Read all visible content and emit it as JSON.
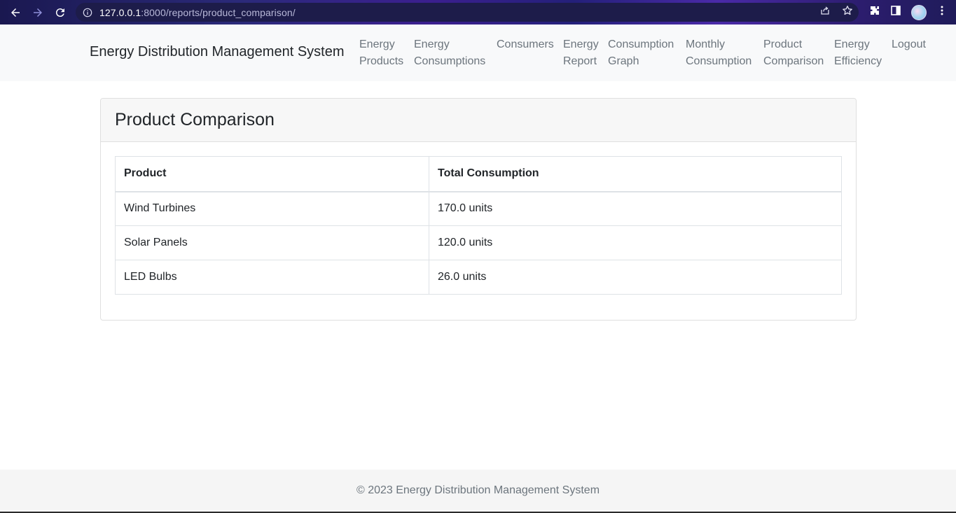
{
  "browser": {
    "url_host": "127.0.0.1",
    "url_rest": ":8000/reports/product_comparison/",
    "icons": [
      "back-arrow-icon",
      "forward-arrow-icon",
      "reload-icon",
      "info-icon",
      "share-icon",
      "star-icon",
      "extensions-icon",
      "side-panel-icon",
      "profile-avatar",
      "more-menu-icon"
    ]
  },
  "navbar": {
    "brand": "Energy Distribution Management System",
    "links": [
      {
        "line1": "Energy",
        "line2": "Products"
      },
      {
        "line1": "Energy",
        "line2": "Consumptions"
      },
      {
        "line1": "Consumers",
        "line2": ""
      },
      {
        "line1": "Energy",
        "line2": "Report"
      },
      {
        "line1": "Consumption",
        "line2": "Graph"
      },
      {
        "line1": "Monthly",
        "line2": "Consumption"
      },
      {
        "line1": "Product",
        "line2": "Comparison"
      },
      {
        "line1": "Energy",
        "line2": "Efficiency"
      },
      {
        "line1": "Logout",
        "line2": ""
      }
    ]
  },
  "card": {
    "title": "Product Comparison",
    "table": {
      "headers": [
        "Product",
        "Total Consumption"
      ],
      "rows": [
        [
          "Wind Turbines",
          "170.0 units"
        ],
        [
          "Solar Panels",
          "120.0 units"
        ],
        [
          "LED Bulbs",
          "26.0 units"
        ]
      ]
    }
  },
  "footer": {
    "text": "© 2023 Energy Distribution Management System"
  }
}
